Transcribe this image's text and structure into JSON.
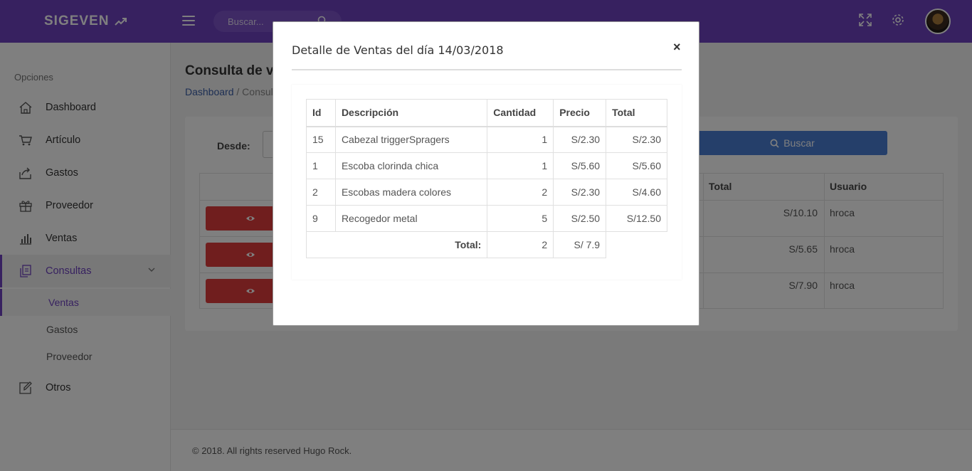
{
  "header": {
    "brand": "SIGEVEN",
    "search_placeholder": "Buscar..."
  },
  "sidebar": {
    "heading": "Opciones",
    "items": [
      {
        "label": "Dashboard",
        "icon": "home-icon"
      },
      {
        "label": "Artículo",
        "icon": "cart-icon"
      },
      {
        "label": "Gastos",
        "icon": "share-icon"
      },
      {
        "label": "Proveedor",
        "icon": "gift-icon"
      },
      {
        "label": "Ventas",
        "icon": "bar-chart-icon"
      },
      {
        "label": "Consultas",
        "icon": "documents-icon"
      },
      {
        "label": "Otros",
        "icon": "edit-icon"
      }
    ],
    "subitems": [
      {
        "label": "Ventas"
      },
      {
        "label": "Gastos"
      },
      {
        "label": "Proveedor"
      }
    ]
  },
  "main": {
    "page_title": "Consulta de ve",
    "breadcrumb_link": "Dashboard",
    "breadcrumb_rest": " / Consul",
    "desde_label": "Desde:",
    "buscar_label": "Buscar",
    "table_headers": {
      "total": "Total",
      "usuario": "Usuario"
    },
    "rows": [
      {
        "total": "S/10.10",
        "usuario": "hroca"
      },
      {
        "total": "S/5.65",
        "usuario": "hroca"
      },
      {
        "total": "S/7.90",
        "usuario": "hroca"
      }
    ]
  },
  "footer": {
    "text": "© 2018. All rights reserved Hugo Rock."
  },
  "modal": {
    "title": "Detalle de Ventas del día 14/03/2018",
    "close": "×",
    "headers": {
      "id": "Id",
      "descripcion": "Descripción",
      "cantidad": "Cantidad",
      "precio": "Precio",
      "total": "Total"
    },
    "rows": [
      {
        "id": "15",
        "descripcion": "Cabezal triggerSpragers",
        "cantidad": "1",
        "precio": "S/2.30",
        "total": "S/2.30"
      },
      {
        "id": "1",
        "descripcion": "Escoba clorinda chica",
        "cantidad": "1",
        "precio": "S/5.60",
        "total": "S/5.60"
      },
      {
        "id": "2",
        "descripcion": "Escobas madera colores",
        "cantidad": "2",
        "precio": "S/2.30",
        "total": "S/4.60"
      },
      {
        "id": "9",
        "descripcion": "Recogedor metal",
        "cantidad": "5",
        "precio": "S/2.50",
        "total": "S/12.50"
      }
    ],
    "footer_row": {
      "label": "Total:",
      "cantidad": "2",
      "total": "S/ 7.9"
    }
  },
  "colors": {
    "primary": "#6f42c1",
    "danger": "#e03c3c",
    "info": "#4a7fd4"
  }
}
